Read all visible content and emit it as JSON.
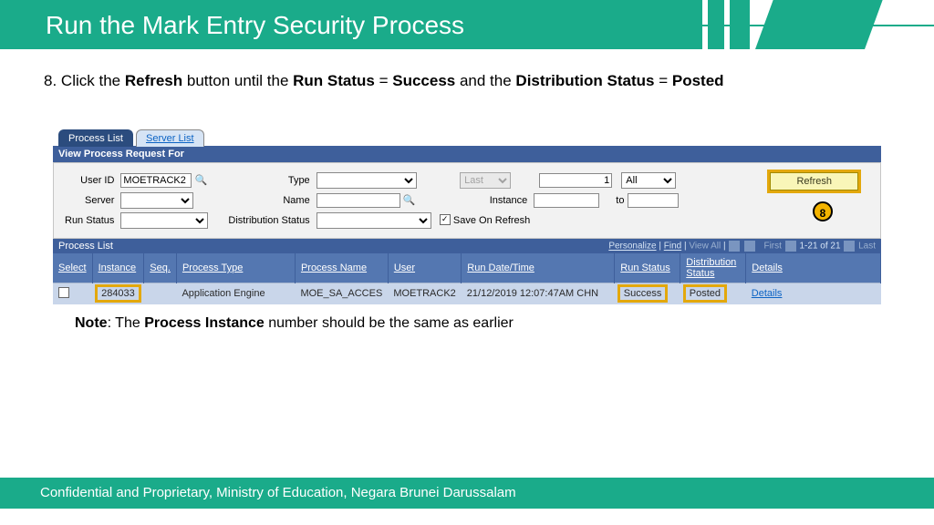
{
  "slide": {
    "title": "Run the Mark Entry Security Process",
    "step_num": "8.",
    "instr_a": "Click the ",
    "instr_b": "Refresh",
    "instr_c": " button until the ",
    "instr_d": "Run Status",
    "instr_e": " = ",
    "instr_f": "Success",
    "instr_g": " and the ",
    "instr_h": "Distribution Status",
    "instr_i": " = ",
    "instr_j": "Posted",
    "callout": "8",
    "note_a": "Note",
    "note_b": ": The ",
    "note_c": "Process Instance",
    "note_d": " number should be the same as earlier",
    "footer": "Confidential and Proprietary, Ministry of Education, Negara Brunei Darussalam"
  },
  "tabs": {
    "active": "Process List",
    "inactive": "Server List"
  },
  "section1": "View Process Request For",
  "filters": {
    "user_id_label": "User ID",
    "user_id": "MOETRACK2",
    "type_label": "Type",
    "last_label": "Last",
    "last_count": "1",
    "last_unit": "All",
    "server_label": "Server",
    "name_label": "Name",
    "instance_label": "Instance",
    "to_label": "to",
    "run_status_label": "Run Status",
    "dist_status_label": "Distribution Status",
    "save_label": "Save On Refresh",
    "refresh_btn": "Refresh"
  },
  "grid": {
    "title": "Process List",
    "personalize": "Personalize",
    "find": "Find",
    "viewall": "View All",
    "paging_a": "First",
    "paging_b": "1-21 of 21",
    "paging_c": "Last",
    "cols": {
      "select": "Select",
      "instance": "Instance",
      "seq": "Seq.",
      "ptype": "Process Type",
      "pname": "Process Name",
      "user": "User",
      "rundt": "Run Date/Time",
      "rstatus": "Run Status",
      "dstatus": "Distribution Status",
      "details": "Details"
    },
    "row": {
      "instance": "284033",
      "seq": "",
      "ptype": "Application Engine",
      "pname": "MOE_SA_ACCES",
      "user": "MOETRACK2",
      "rundt": "21/12/2019 12:07:47AM CHN",
      "rstatus": "Success",
      "dstatus": "Posted",
      "details": "Details"
    }
  }
}
